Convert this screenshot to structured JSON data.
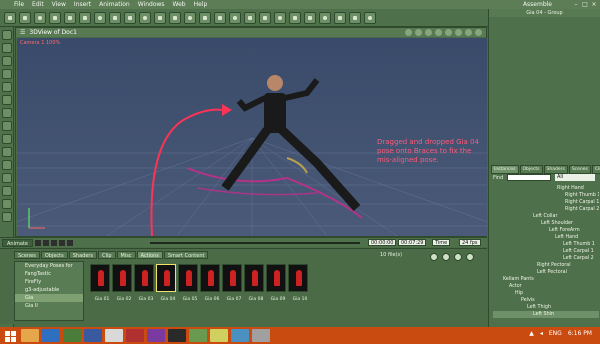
{
  "menubar": {
    "items": [
      "File",
      "Edit",
      "View",
      "Insert",
      "Animation",
      "Windows",
      "Web",
      "Help"
    ],
    "app_title": "Assemble"
  },
  "view": {
    "title": "3DView of Doc1",
    "camera_label": "Camera 1 100%",
    "annotation": "Dragged and dropped Gia 04 pose onto Braces to fix the mis-aligned pose."
  },
  "timeline": {
    "tab_label": "Animate",
    "time_a": "00:00:00",
    "time_b": "00:07:29",
    "speed": "Time",
    "fps": "24 fps"
  },
  "content": {
    "tabs": [
      "Scenes",
      "Objects",
      "Shaders",
      "Clip",
      "Misc",
      "Actions",
      "Smart Content"
    ],
    "active_tab": "Actions",
    "file_count": "10 file(s)",
    "tree": [
      "Everyday Poses for",
      "FangTastic",
      "FireFly",
      "g3-adjustable",
      "Gia",
      "Gia II"
    ],
    "selected_tree": "Gia",
    "thumbs": [
      "Gia 01",
      "Gia 02",
      "Gia 03",
      "Gia 04",
      "Gia 05",
      "Gia 06",
      "Gia 07",
      "Gia 08",
      "Gia 09",
      "Gia 10"
    ],
    "selected_thumb": "Gia 04"
  },
  "right_panel": {
    "title": "Gia 04 - Group",
    "tabs": [
      "Instances",
      "Objects",
      "Shaders",
      "Scenes",
      "Clips"
    ],
    "find_label": "Find",
    "filter_value": "All",
    "tree": [
      "Right Hand",
      "Right Thumb 1",
      "Right Carpal 1",
      "Right Carpal 2",
      "Left Collar",
      "Left Shoulder",
      "Left ForeArm",
      "Left Hand",
      "Left Thumb 1",
      "Left Carpal 1",
      "Left Carpal 2",
      "Right Pectoral",
      "Left Pectoral",
      "Kellam Pants",
      "Actor",
      "Hip",
      "Pelvis",
      "Left Thigh",
      "Left Shin"
    ],
    "selected": "Left Shin"
  },
  "taskbar": {
    "lang": "ENG",
    "time": "6:16 PM"
  }
}
